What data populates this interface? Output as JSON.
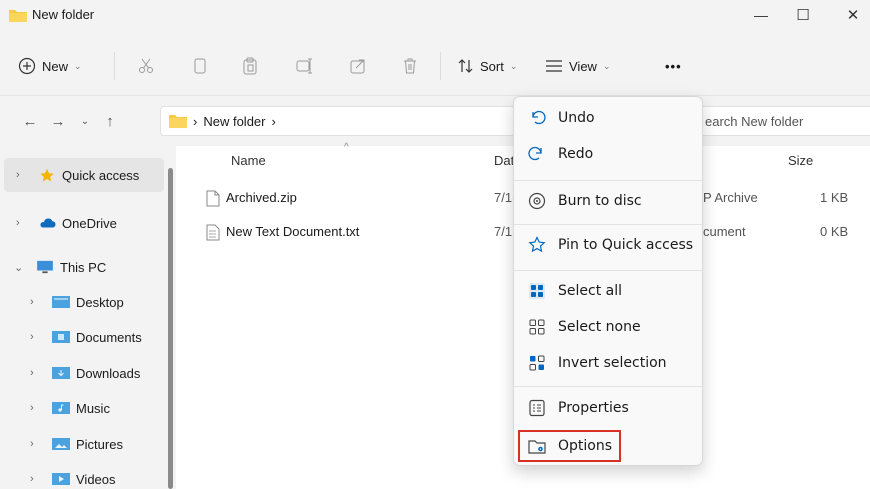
{
  "window": {
    "title": "New folder",
    "controls": {
      "minimize": "—",
      "maximize": "☐",
      "close": "✕"
    }
  },
  "toolbar": {
    "new_label": "New",
    "sort_label": "Sort",
    "view_label": "View",
    "more_label": "•••",
    "icons": [
      "cut-icon",
      "copy-icon",
      "paste-icon",
      "rename-icon",
      "share-icon",
      "delete-icon"
    ]
  },
  "address": {
    "path_separator": "›",
    "path": "New folder",
    "trailing_separator": "›",
    "search_placeholder": "earch New folder"
  },
  "sidebar": {
    "items": [
      {
        "label": "Quick access",
        "arrow": "›",
        "icon": "star-icon"
      },
      {
        "label": "OneDrive",
        "arrow": "›",
        "icon": "cloud-icon"
      },
      {
        "label": "This PC",
        "arrow": "⌄",
        "icon": "pc-icon"
      },
      {
        "label": "Desktop",
        "arrow": "›",
        "icon": "folder-icon"
      },
      {
        "label": "Documents",
        "arrow": "›",
        "icon": "folder-icon"
      },
      {
        "label": "Downloads",
        "arrow": "›",
        "icon": "folder-icon"
      },
      {
        "label": "Music",
        "arrow": "›",
        "icon": "folder-icon"
      },
      {
        "label": "Pictures",
        "arrow": "›",
        "icon": "folder-icon"
      },
      {
        "label": "Videos",
        "arrow": "›",
        "icon": "folder-icon"
      }
    ]
  },
  "files": {
    "columns": {
      "name": "Name",
      "date": "Dat",
      "size": "Size"
    },
    "rows": [
      {
        "name": "Archived.zip",
        "date": "7/1(",
        "type": "P Archive",
        "size": "1 KB"
      },
      {
        "name": "New Text Document.txt",
        "date": "7/1·",
        "type": "cument",
        "size": "0 KB"
      }
    ]
  },
  "context_menu": {
    "items": [
      {
        "label": "Undo",
        "icon": "undo-icon"
      },
      {
        "label": "Redo",
        "icon": "redo-icon"
      },
      {
        "label": "Burn to disc",
        "icon": "disc-icon"
      },
      {
        "label": "Pin to Quick access",
        "icon": "pin-star-icon"
      },
      {
        "label": "Select all",
        "icon": "select-all-icon"
      },
      {
        "label": "Select none",
        "icon": "select-none-icon"
      },
      {
        "label": "Invert selection",
        "icon": "invert-selection-icon"
      },
      {
        "label": "Properties",
        "icon": "properties-icon"
      },
      {
        "label": "Options",
        "icon": "options-icon"
      }
    ]
  },
  "colors": {
    "accent": "#0067c0",
    "folder": "#f7c948",
    "highlight_box": "#d93025"
  }
}
